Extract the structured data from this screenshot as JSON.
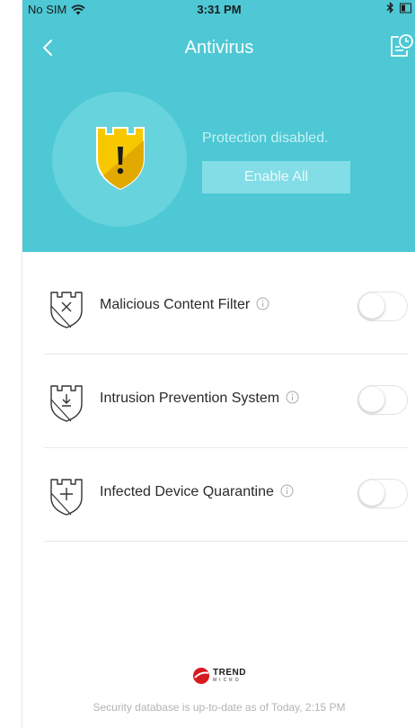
{
  "status_bar": {
    "carrier": "No SIM",
    "time": "3:31 PM"
  },
  "nav": {
    "title": "Antivirus"
  },
  "hero": {
    "status_text": "Protection disabled.",
    "enable_label": "Enable All"
  },
  "features": [
    {
      "label": "Malicious Content Filter",
      "icon": "shield-x-icon",
      "enabled": false
    },
    {
      "label": "Intrusion Prevention System",
      "icon": "shield-download-icon",
      "enabled": false
    },
    {
      "label": "Infected Device Quarantine",
      "icon": "shield-plus-icon",
      "enabled": false
    }
  ],
  "footer": {
    "brand_name": "TREND",
    "brand_sub": "MICRO",
    "database_status": "Security database is up-to-date as of Today, 2:15 PM"
  },
  "colors": {
    "hero_bg": "#4dc8d4",
    "shield_yellow": "#f7c800",
    "brand_red": "#d71920"
  }
}
